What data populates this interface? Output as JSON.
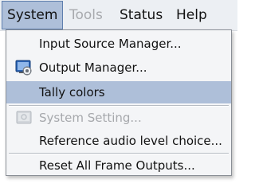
{
  "menubar": {
    "items": [
      {
        "label": "System",
        "state": "open"
      },
      {
        "label": "Tools",
        "state": "disabled"
      },
      {
        "label": "Status",
        "state": "normal"
      },
      {
        "label": "Help",
        "state": "normal"
      }
    ]
  },
  "system_menu": {
    "items": [
      {
        "label": "Input Source Manager...",
        "icon": null,
        "state": "normal"
      },
      {
        "label": "Output Manager...",
        "icon": "output-manager-icon",
        "state": "normal"
      },
      {
        "label": "Tally colors",
        "icon": null,
        "state": "highlighted"
      },
      {
        "label": "System Setting...",
        "icon": "system-setting-icon",
        "state": "disabled"
      },
      {
        "label": "Reference audio level choice...",
        "icon": null,
        "state": "normal"
      },
      {
        "label": "Reset All Frame Outputs...",
        "icon": null,
        "state": "normal"
      }
    ]
  },
  "colors": {
    "menubar_bg": "#eceff3",
    "highlight": "#aebfd9",
    "disabled_text": "#a6a8ac",
    "menu_bg": "#f4f5f7"
  }
}
